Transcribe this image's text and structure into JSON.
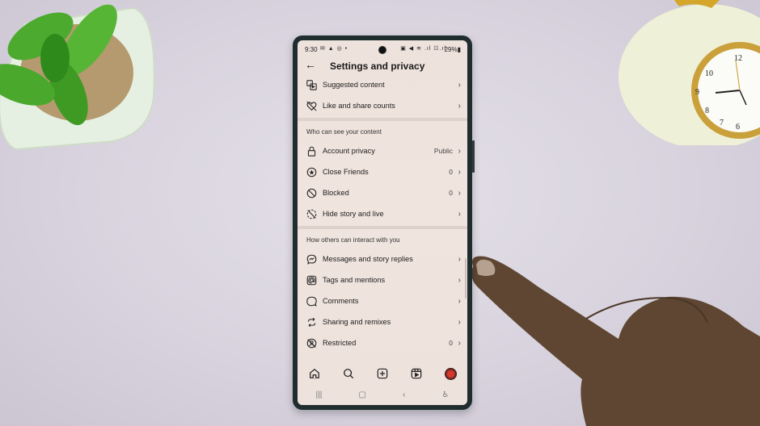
{
  "statusbar": {
    "time": "9:30",
    "left_icons": "✉ ▲ ◎ •",
    "right_icons": "▣ ◀ ≋ .ıl ☷.ıl",
    "battery": "29%▮"
  },
  "appbar": {
    "back_icon": "←",
    "title": "Settings and privacy"
  },
  "top_items": [
    {
      "label": "Suggested content",
      "value": "",
      "icon": "suggested-content-icon"
    },
    {
      "label": "Like and share counts",
      "value": "",
      "icon": "heart-slash-icon"
    }
  ],
  "section1": {
    "heading": "Who can see your content",
    "items": [
      {
        "label": "Account privacy",
        "value": "Public",
        "icon": "lock-icon"
      },
      {
        "label": "Close Friends",
        "value": "0",
        "icon": "star-circle-icon"
      },
      {
        "label": "Blocked",
        "value": "0",
        "icon": "blocked-icon"
      },
      {
        "label": "Hide story and live",
        "value": "",
        "icon": "hide-story-icon"
      }
    ]
  },
  "section2": {
    "heading": "How others can interact with you",
    "items": [
      {
        "label": "Messages and story replies",
        "value": "",
        "icon": "messenger-icon"
      },
      {
        "label": "Tags and mentions",
        "value": "",
        "icon": "at-sign-icon"
      },
      {
        "label": "Comments",
        "value": "",
        "icon": "comment-icon"
      },
      {
        "label": "Sharing and remixes",
        "value": "",
        "icon": "remix-icon"
      },
      {
        "label": "Restricted",
        "value": "0",
        "icon": "restricted-icon"
      }
    ]
  },
  "chevron": "›",
  "bottom_nav": [
    "home",
    "search",
    "create",
    "reels",
    "profile"
  ],
  "system_nav": {
    "recents": "|||",
    "home": "▢",
    "back": "‹",
    "accessibility": "♿︎"
  }
}
